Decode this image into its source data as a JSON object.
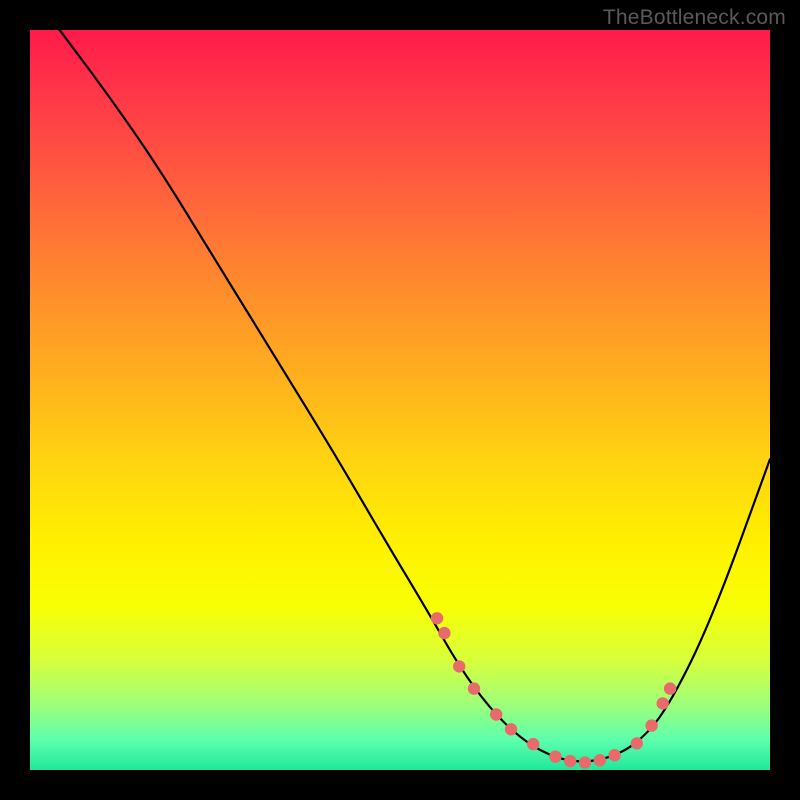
{
  "watermark": "TheBottleneck.com",
  "chart_data": {
    "type": "line",
    "title": "",
    "xlabel": "",
    "ylabel": "",
    "xlim": [
      0,
      100
    ],
    "ylim": [
      0,
      100
    ],
    "series": [
      {
        "name": "curve",
        "x": [
          4,
          10,
          17,
          25,
          33,
          41,
          48,
          54,
          58,
          62,
          66,
          70,
          74,
          78,
          82,
          86,
          92,
          100
        ],
        "y": [
          100,
          92,
          82,
          69,
          56,
          43,
          31,
          21,
          14,
          8.5,
          4.5,
          2,
          1,
          1.5,
          3.5,
          8,
          20,
          42
        ]
      }
    ],
    "markers": {
      "name": "data-points",
      "x": [
        55,
        56,
        58,
        60,
        63,
        65,
        68,
        71,
        73,
        75,
        77,
        79,
        82,
        84,
        85.5,
        86.5
      ],
      "y": [
        20.5,
        18.5,
        14,
        11,
        7.5,
        5.5,
        3.5,
        1.8,
        1.2,
        1,
        1.3,
        2,
        3.6,
        6,
        9,
        11
      ]
    },
    "gradient_stops": [
      {
        "pos": 0,
        "color": "#ff1a4a"
      },
      {
        "pos": 20,
        "color": "#ff5b3f"
      },
      {
        "pos": 46,
        "color": "#ffad1f"
      },
      {
        "pos": 70,
        "color": "#fff200"
      },
      {
        "pos": 91,
        "color": "#9fff78"
      },
      {
        "pos": 100,
        "color": "#20e89a"
      }
    ]
  }
}
